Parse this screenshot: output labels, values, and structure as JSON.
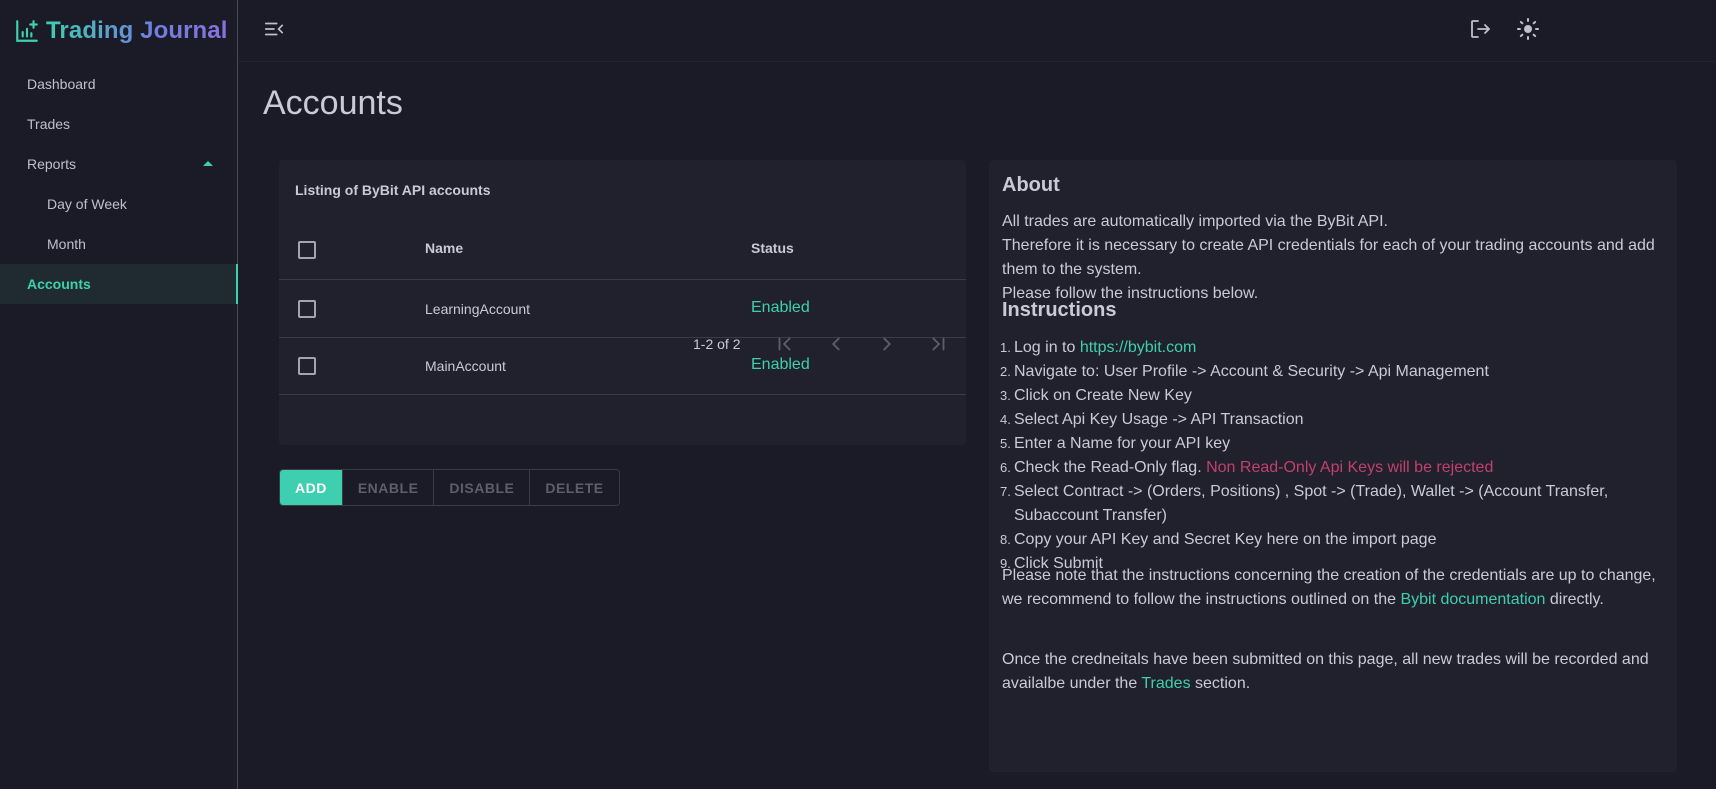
{
  "app": {
    "title": "Trading Journal"
  },
  "sidebar": {
    "items": [
      {
        "label": "Dashboard"
      },
      {
        "label": "Trades"
      },
      {
        "label": "Reports"
      },
      {
        "label": "Day of Week"
      },
      {
        "label": "Month"
      },
      {
        "label": "Accounts"
      }
    ],
    "active": "Accounts"
  },
  "page": {
    "title": "Accounts"
  },
  "table": {
    "caption": "Listing of ByBit API accounts",
    "columns": [
      "Name",
      "Status"
    ],
    "rows": [
      {
        "name": "LearningAccount",
        "status": "Enabled"
      },
      {
        "name": "MainAccount",
        "status": "Enabled"
      }
    ],
    "pagination": "1-2 of 2"
  },
  "actions": {
    "add": "ADD",
    "enable": "ENABLE",
    "disable": "DISABLE",
    "delete": "DELETE"
  },
  "about": {
    "heading": "About",
    "lines": [
      "All trades are automatically imported via the ByBit API.",
      "Therefore it is necessary to create API credentials for each of your trading accounts and add them to the system.",
      "Please follow the instructions below."
    ],
    "instructions_heading": "Instructions",
    "steps": [
      {
        "text": "Log in to ",
        "link": "https://bybit.com"
      },
      {
        "text": "Navigate to: User Profile -> Account & Security -> Api Management"
      },
      {
        "text": "Click on Create New Key"
      },
      {
        "text": "Select Api Key Usage -> API Transaction"
      },
      {
        "text": "Enter a Name for your API key"
      },
      {
        "text": "Check the Read-Only flag. ",
        "warning": "Non Read-Only Api Keys will be rejected"
      },
      {
        "text": "Select Contract -> (Orders, Positions) , Spot -> (Trade), Wallet -> (Account Transfer, Subaccount Transfer)"
      },
      {
        "text": "Copy your API Key and Secret Key here on the import page"
      },
      {
        "text": "Click Submit"
      }
    ],
    "note_before": "Please note that the instructions concerning the creation of the credentials are up to change, we recommend to follow the instructions outlined on the ",
    "note_link": "Bybit documentation",
    "note_after": " directly.",
    "footer_before": "Once the credneitals have been submitted on this page, all new trades will be recorded and availalbe under the ",
    "footer_link": "Trades",
    "footer_after": " section."
  },
  "colors": {
    "accent": "#3ecfb0",
    "warning": "#c2406e",
    "background": "#1a1b26",
    "card": "#20212d"
  },
  "icons": {
    "brand": "chart-plus-icon",
    "menu_toggle": "menu-collapse-icon",
    "logout": "logout-icon",
    "theme": "sun-icon"
  }
}
